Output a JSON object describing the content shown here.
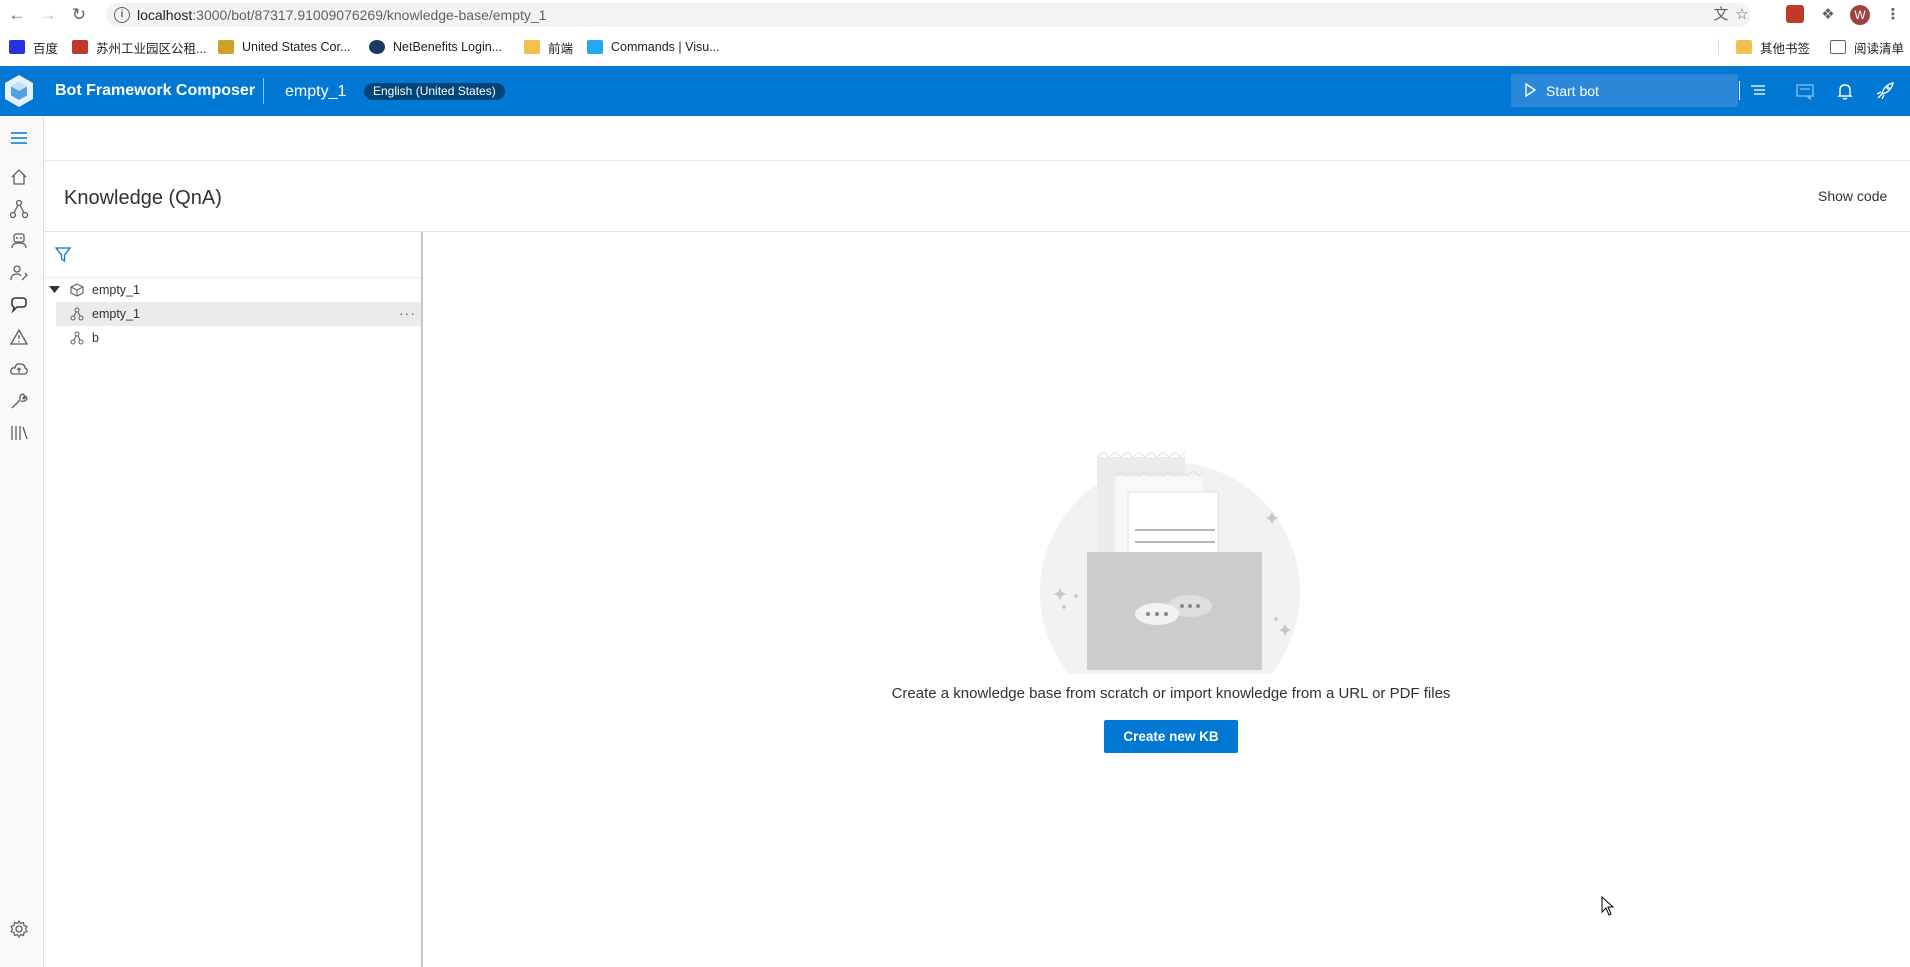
{
  "browser": {
    "url_host": "localhost",
    "url_path": ":3000/bot/87317.91009076269/knowledge-base/empty_1",
    "profile_initial": "W",
    "bookmarks": [
      {
        "label": "百度",
        "color": "#2932e1"
      },
      {
        "label": "苏州工业园区公租...",
        "color": "#c0392b"
      },
      {
        "label": "United States Cor...",
        "color": "#c9a227"
      },
      {
        "label": "NetBenefits Login...",
        "color": "#1c3a5f"
      },
      {
        "label": "前端",
        "color": "#f2c04d"
      },
      {
        "label": "Commands | Visu...",
        "color": "#23a9f2"
      }
    ],
    "bookmarks_right": [
      {
        "label": "其他书签",
        "color": "#f2c04d"
      },
      {
        "label": "阅读清单",
        "color": "#5f6368"
      }
    ]
  },
  "header": {
    "app_title": "Bot Framework Composer",
    "bot_name": "empty_1",
    "locale": "English (United States)",
    "start_bot_label": "Start bot",
    "brand_color": "#0078d4"
  },
  "left_nav": {
    "items": [
      "hamburger-icon",
      "home-icon",
      "design-icon",
      "bot-responses-icon",
      "user-input-icon",
      "qna-icon",
      "diagnostics-icon",
      "publish-icon",
      "bot-settings-icon",
      "package-manager-icon",
      "settings-icon"
    ],
    "active": "qna-icon"
  },
  "page": {
    "title": "Knowledge (QnA)",
    "show_code": "Show code"
  },
  "tree": {
    "root_label": "empty_1",
    "items": [
      {
        "label": "empty_1",
        "selected": true,
        "more": "···"
      },
      {
        "label": "b",
        "selected": false
      }
    ]
  },
  "empty_state": {
    "message": "Create a knowledge base from scratch or import knowledge from a URL or PDF files",
    "button_label": "Create new KB"
  }
}
